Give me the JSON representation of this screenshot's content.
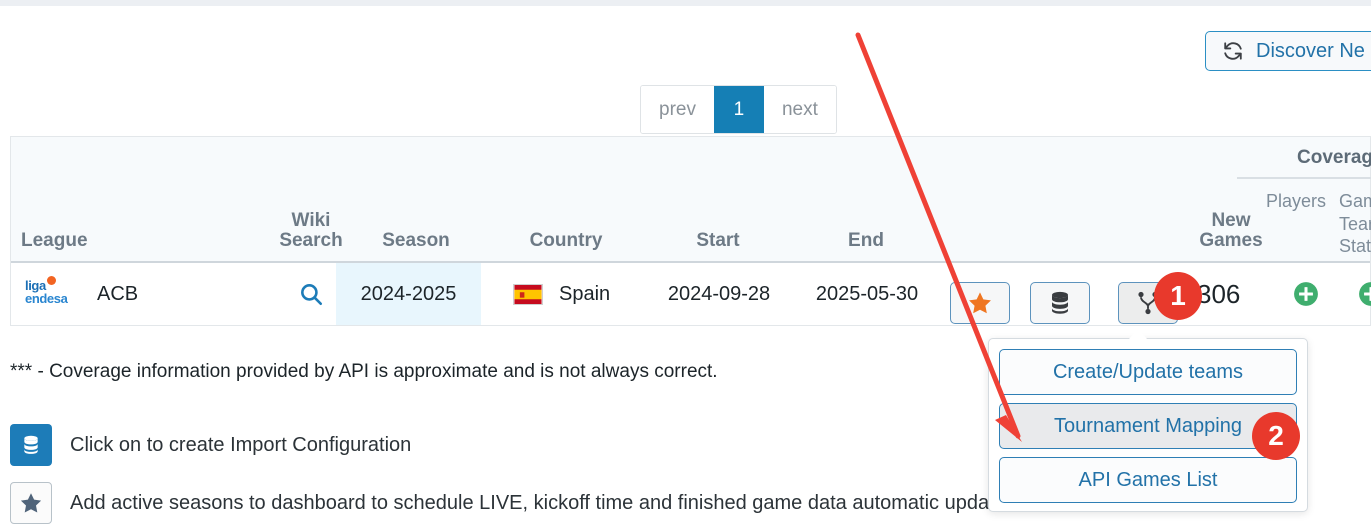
{
  "toolbar": {
    "discover_label": "Discover Ne",
    "discover_icon": "refresh-icon"
  },
  "pagination": {
    "prev_label": "prev",
    "current_page": "1",
    "next_label": "next"
  },
  "table": {
    "coverage_group_label": "Coverage",
    "headers": {
      "league": "League",
      "wiki_search": "Wiki\nSearch",
      "wiki_search_line1": "Wiki",
      "wiki_search_line2": "Search",
      "season": "Season",
      "country": "Country",
      "start": "Start",
      "end": "End",
      "new_games_line1": "New",
      "new_games_line2": "Games",
      "players": "Players",
      "games_line1": "Gam",
      "games_line2": "Tear",
      "games_line3": "Stats"
    },
    "rows": [
      {
        "league_logo": "liga-endesa-logo",
        "league_logo_line1": "liga",
        "league_logo_line2": "endesa",
        "league": "ACB",
        "wiki_search_icon": "search-icon",
        "season": "2024-2025",
        "country_flag": "flag-spain-icon",
        "country": "Spain",
        "start": "2024-09-28",
        "end": "2025-05-30",
        "action_star_icon": "star-icon",
        "action_database_icon": "database-icon",
        "action_mapping_icon": "sitemap-icon",
        "new_games": "306",
        "players_add_icon": "plus-circle-icon",
        "games_add_icon": "plus-circle-icon"
      }
    ]
  },
  "footnote": "*** - Coverage information provided by API is approximate and is not always correct.",
  "legend": [
    {
      "icon": "database-icon",
      "style": "filled",
      "text": "Click on to create Import Configuration"
    },
    {
      "icon": "star-icon",
      "style": "outlined",
      "text": "Add active seasons to dashboard to schedule LIVE, kickoff time and finished game data automatic updates"
    }
  ],
  "dropdown": {
    "items": [
      {
        "label": "Create/Update teams",
        "state": "normal"
      },
      {
        "label": "Tournament Mapping",
        "state": "hover"
      },
      {
        "label": "API Games List",
        "state": "normal"
      }
    ]
  },
  "annotations": {
    "arrow_color": "#ef4136",
    "badge_color": "#e8392c",
    "badges": [
      {
        "number": "1"
      },
      {
        "number": "2"
      }
    ]
  },
  "colors": {
    "accent_blue": "#157fb5",
    "link_blue": "#2272a8",
    "header_gray": "#6d7a86",
    "season_highlight": "#e8f6fd",
    "green": "#3fae6e",
    "orange": "#ef7622"
  }
}
